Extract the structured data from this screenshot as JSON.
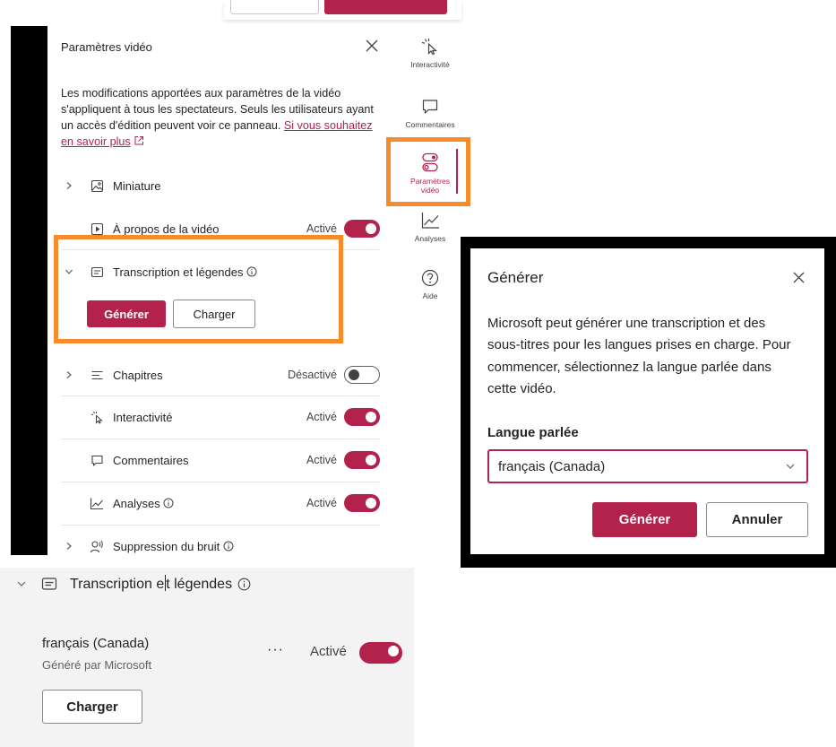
{
  "panel": {
    "title": "Paramètres vidéo",
    "description": "Les modifications apportées aux paramètres de la vidéo s'appliquent à tous les spectateurs. Seuls les utilisateurs ayant un accès d'édition peuvent voir ce panneau.",
    "learn_more_link": "Si vous souhaitez en savoir plus",
    "rows": [
      {
        "label": "Miniature"
      },
      {
        "label": "À propos de la vidéo",
        "status": "Activé"
      },
      {
        "label": "Transcription et légendes"
      },
      {
        "label": "Chapitres",
        "status": "Désactivé"
      },
      {
        "label": "Interactivité",
        "status": "Activé"
      },
      {
        "label": "Commentaires",
        "status": "Activé"
      },
      {
        "label": "Analyses",
        "status": "Activé"
      },
      {
        "label": "Suppression du bruit"
      }
    ],
    "generate_button": "Générer",
    "upload_button": "Charger"
  },
  "rail": {
    "items": [
      {
        "label": "Interactivité"
      },
      {
        "label": "Commentaires"
      },
      {
        "label": "Paramètres vidéo"
      },
      {
        "label": "Analyses"
      },
      {
        "label": "Aide"
      }
    ]
  },
  "dialog": {
    "title": "Générer",
    "text": "Microsoft peut générer une transcription et des sous-titres pour les langues prises en charge. Pour commencer, sélectionnez la langue parlée dans cette vidéo.",
    "field_label": "Langue parlée",
    "selected_language": "français (Canada)",
    "generate_button": "Générer",
    "cancel_button": "Annuler"
  },
  "bottom": {
    "title_part1": "Transcription e",
    "title_part2": "t légendes",
    "language": "français (Canada)",
    "sublabel": "Généré par Microsoft",
    "more": "···",
    "status": "Activé",
    "upload_button": "Charger"
  },
  "colors": {
    "accent": "#b3224b",
    "highlight": "#f78b2b"
  }
}
